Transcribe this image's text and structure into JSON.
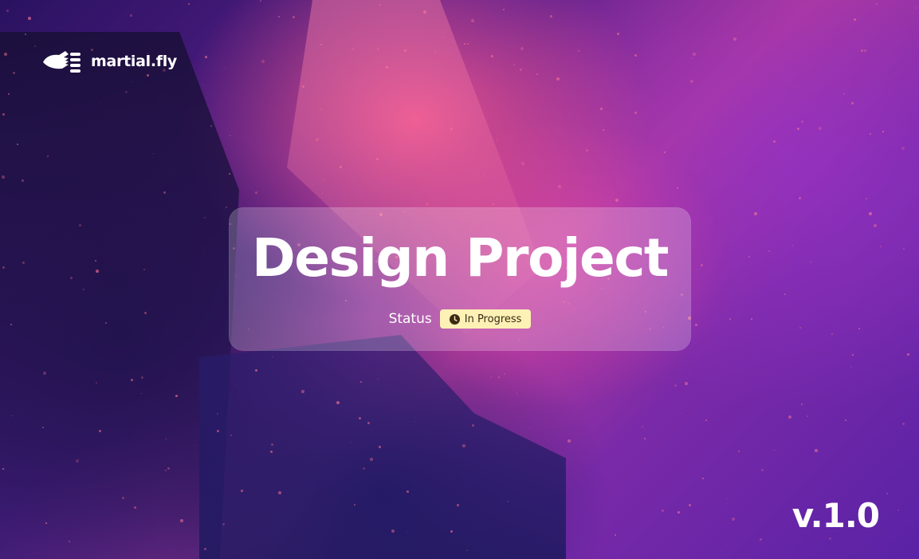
{
  "brand": {
    "logo_icon": "winged-fist-icon",
    "name": "martial.fly"
  },
  "cover": {
    "title": "Design Project",
    "status_label": "Status",
    "status_icon": "clock-icon",
    "status_value": "In Progress",
    "version": "v.1.0"
  },
  "colors": {
    "badge_background": "#fdf1b5",
    "badge_text": "#3b2a14",
    "text": "#ffffff"
  }
}
